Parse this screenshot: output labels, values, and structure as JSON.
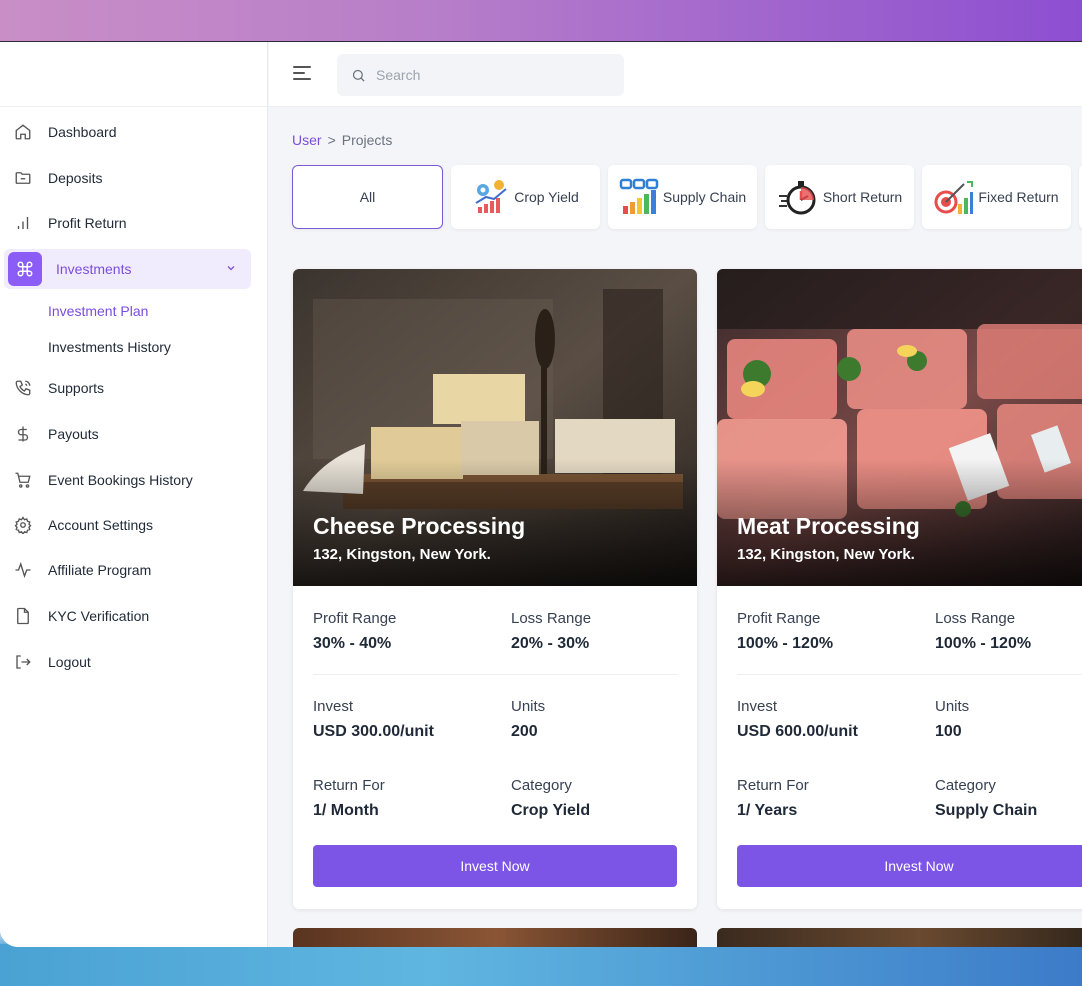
{
  "sidebar": {
    "items": [
      {
        "label": "Dashboard",
        "icon": "home-icon"
      },
      {
        "label": "Deposits",
        "icon": "folder-icon"
      },
      {
        "label": "Profit Return",
        "icon": "bar-chart-icon"
      },
      {
        "label": "Investments",
        "icon": "command-icon"
      },
      {
        "label": "Supports",
        "icon": "phone-icon"
      },
      {
        "label": "Payouts",
        "icon": "dollar-icon"
      },
      {
        "label": "Event Bookings History",
        "icon": "cart-icon"
      },
      {
        "label": "Account Settings",
        "icon": "gear-icon"
      },
      {
        "label": "Affiliate Program",
        "icon": "activity-icon"
      },
      {
        "label": "KYC Verification",
        "icon": "file-icon"
      },
      {
        "label": "Logout",
        "icon": "logout-icon"
      }
    ],
    "submenu": [
      {
        "label": "Investment Plan"
      },
      {
        "label": "Investments History"
      }
    ]
  },
  "topbar": {
    "search_placeholder": "Search"
  },
  "breadcrumb": {
    "root": "User",
    "separator": ">",
    "current": "Projects"
  },
  "categories": [
    {
      "label": "All"
    },
    {
      "label": "Crop Yield"
    },
    {
      "label": "Supply Chain"
    },
    {
      "label": "Short Return"
    },
    {
      "label": "Fixed Return"
    }
  ],
  "projects": [
    {
      "title": "Cheese Processing",
      "address": "132, Kingston, New York.",
      "profit_label": "Profit Range",
      "profit": "30% - 40%",
      "loss_label": "Loss Range",
      "loss": "20% - 30%",
      "invest_label": "Invest",
      "invest": "USD 300.00/unit",
      "units_label": "Units",
      "units": "200",
      "return_label": "Return For",
      "return": "1/ Month",
      "category_label": "Category",
      "category": "Crop Yield",
      "button": "Invest Now"
    },
    {
      "title": "Meat Processing",
      "address": "132, Kingston, New York.",
      "profit_label": "Profit Range",
      "profit": "100% - 120%",
      "loss_label": "Loss Range",
      "loss": "100% - 120%",
      "invest_label": "Invest",
      "invest": "USD 600.00/unit",
      "units_label": "Units",
      "units": "100",
      "return_label": "Return For",
      "return": "1/ Years",
      "category_label": "Category",
      "category": "Supply Chain",
      "button": "Invest Now"
    }
  ],
  "colors": {
    "accent": "#7c55e6",
    "accent_light": "#f1ecfd"
  }
}
